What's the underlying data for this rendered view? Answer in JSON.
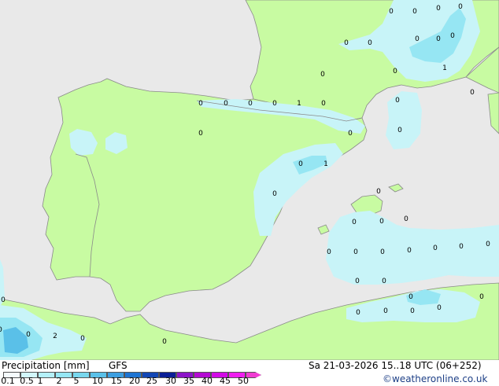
{
  "legend": {
    "title": "Precipitation [mm]",
    "model": "GFS",
    "datetime": "Sa 21-03-2026 15..18 UTC (06+252)",
    "credit": "©weatheronline.co.uk",
    "scale_labels": [
      "0.1",
      "0.5",
      "1",
      "2",
      "5",
      "10",
      "15",
      "20",
      "25",
      "30",
      "35",
      "40",
      "45",
      "50"
    ],
    "scale_colors": [
      "#f5fbfd",
      "#d2f7fb",
      "#b4f0f8",
      "#96e6f3",
      "#78d7ee",
      "#5ac0e8",
      "#3c9ee0",
      "#1e74d2",
      "#1246b4",
      "#0a1e96",
      "#8c14c8",
      "#b40ad2",
      "#d20ae6",
      "#f01ef0",
      "#f03cd2"
    ]
  },
  "map": {
    "colors": {
      "sea": "#e9e9e9",
      "land": "#c8fba2",
      "precip_light": "#c8f4f8",
      "precip_mid": "#96e6f3",
      "precip_heavy": "#5ac0e8",
      "border": "#8a8a8a"
    },
    "value_labels": [
      "0",
      "0",
      "0",
      "0",
      "0",
      "0",
      "0",
      "0",
      "0",
      "0",
      "1",
      "0",
      "0",
      "0",
      "0",
      "0",
      "1",
      "0",
      "0",
      "0",
      "0",
      "0",
      "0",
      "1",
      "0",
      "0",
      "0",
      "0",
      "0",
      "0",
      "0",
      "0",
      "0",
      "0",
      "0",
      "0",
      "0",
      "0",
      "0",
      "0",
      "0",
      "0",
      "0",
      "0",
      "0",
      "0",
      "0",
      "2",
      "0",
      "0",
      "0"
    ]
  }
}
